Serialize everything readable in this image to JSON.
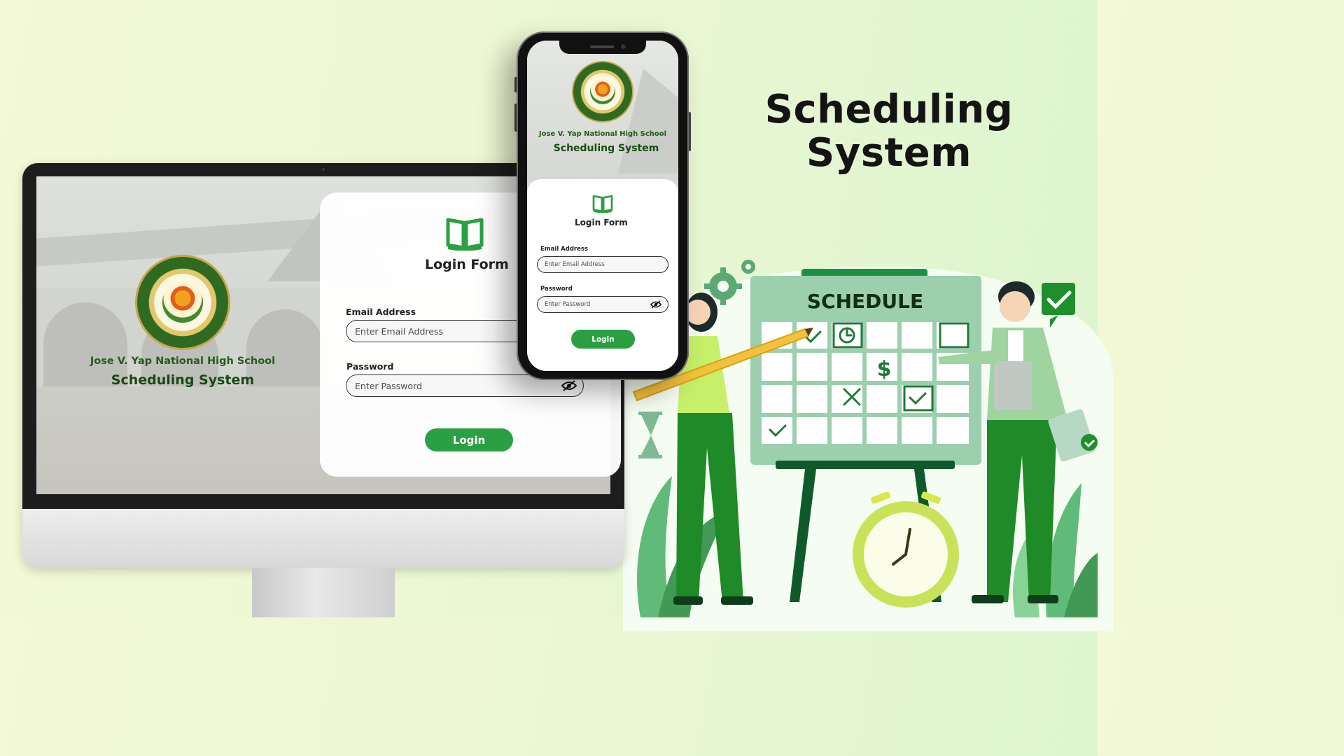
{
  "promo": {
    "title_line1": "Scheduling",
    "title_line2": "System"
  },
  "desktop": {
    "school_name": "Jose V. Yap National High School",
    "system_name": "Scheduling System",
    "login_form": {
      "title": "Login Form",
      "email_label": "Email Address",
      "email_placeholder": "Enter Email Address",
      "password_label": "Password",
      "password_placeholder": "Enter Password",
      "login_button": "Login"
    }
  },
  "mobile": {
    "school_name": "Jose V. Yap National High School",
    "system_name": "Scheduling System",
    "login_form": {
      "title": "Login Form",
      "email_label": "Email Address",
      "email_placeholder": "Enter Email Address",
      "password_label": "Password",
      "password_placeholder": "Enter Password",
      "login_button": "Login"
    }
  },
  "illustration": {
    "board_title": "SCHEDULE"
  },
  "icons": {
    "logo": "school-seal-icon",
    "form": "open-book-icon",
    "password_toggle": "eye-off-icon"
  },
  "colors": {
    "accent": "#2aa043",
    "dark_green": "#174a12",
    "board_green": "#8fc7a0",
    "person_green": "#1f8f2e"
  }
}
